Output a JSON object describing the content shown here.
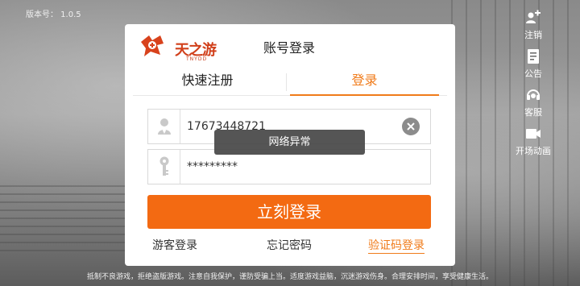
{
  "version_label": "版本号： 1.0.5",
  "right_menu": {
    "logout": {
      "label": "注销",
      "icon": "logout-icon"
    },
    "notice": {
      "label": "公告",
      "icon": "notice-icon"
    },
    "service": {
      "label": "客服",
      "icon": "service-icon"
    },
    "intro": {
      "label": "开场动画",
      "icon": "video-icon"
    }
  },
  "panel": {
    "logo_text": "天之游",
    "logo_sub": "TNYDD",
    "title": "账号登录",
    "tabs": {
      "register": "快速注册",
      "login": "登录"
    },
    "username_value": "17673448721",
    "password_value": "*********",
    "login_button": "立刻登录",
    "links": {
      "guest": "游客登录",
      "forget": "忘记密码",
      "code": "验证码登录"
    }
  },
  "toast": "网络异常",
  "footer_notice": "抵制不良游戏，拒绝盗版游戏。注意自我保护，谨防受骗上当。适度游戏益脑，沉迷游戏伤身。合理安排时间，享受健康生活。",
  "colors": {
    "accent": "#f36a12",
    "tab_active": "#f07b1a",
    "logo": "#d1401b"
  }
}
